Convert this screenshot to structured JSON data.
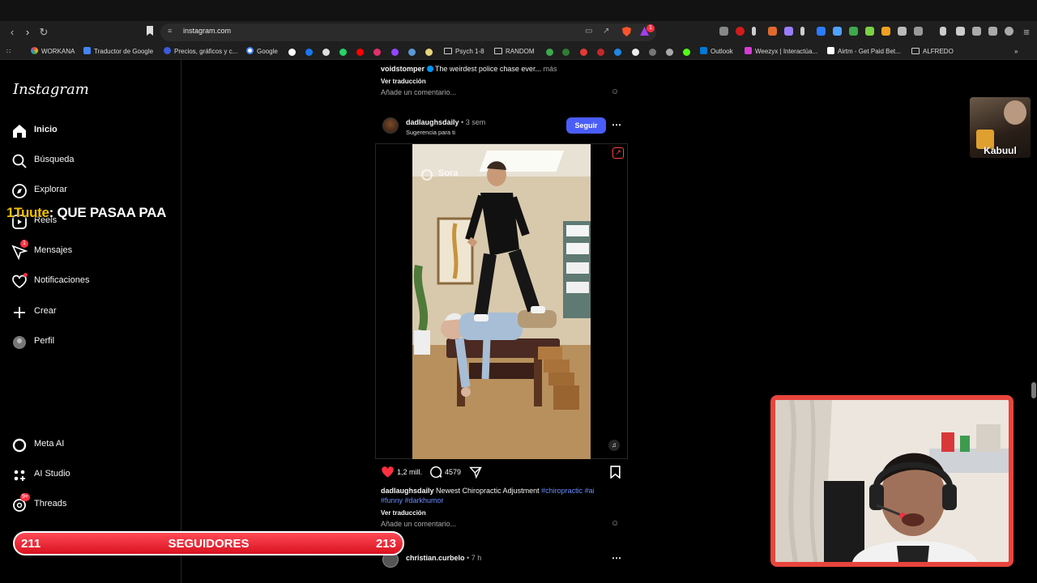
{
  "browser": {
    "url": "instagram.com",
    "bookmarks": [
      "WORKANA",
      "Traductor de Google",
      "Precios, gráficos y c...",
      "Google",
      "Psych 1-8",
      "RANDOM",
      "Outlook",
      "Weezyx | Interactúa...",
      "Airtm - Get Paid Bet...",
      "ALFREDO"
    ],
    "brave_badge": "1"
  },
  "sidebar": {
    "logo": "Instagram",
    "nav": [
      {
        "label": "Inicio",
        "icon": "home-icon",
        "active": true
      },
      {
        "label": "Búsqueda",
        "icon": "search-icon"
      },
      {
        "label": "Explorar",
        "icon": "compass-icon"
      },
      {
        "label": "Reels",
        "icon": "reels-icon"
      },
      {
        "label": "Mensajes",
        "icon": "messenger-icon",
        "badge": "1"
      },
      {
        "label": "Notificaciones",
        "icon": "heart-icon"
      },
      {
        "label": "Crear",
        "icon": "plus-icon"
      },
      {
        "label": "Perfil",
        "icon": "avatar-icon"
      }
    ],
    "bottom": [
      {
        "label": "Meta AI",
        "icon": "meta-ai-icon"
      },
      {
        "label": "AI Studio",
        "icon": "ai-studio-icon"
      },
      {
        "label": "Threads",
        "icon": "threads-icon",
        "badge": "9+"
      }
    ]
  },
  "prev_post": {
    "username": "voidstomper",
    "caption": "The weirdest police chase ever...",
    "more": "más",
    "translate": "Ver traducción",
    "comment_placeholder": "Añade un comentario..."
  },
  "post": {
    "username": "dadlaughsdaily",
    "time": "3 sem",
    "suggestion": "Sugerencia para ti",
    "follow": "Seguir",
    "watermark": "Sora",
    "likes": "1,2 mill.",
    "comments": "4579",
    "caption": "Newest Chiropractic Adjustment",
    "hashtags_line1": "#chiropractic #ai",
    "hashtags_line2": "#funny #darkhumor",
    "translate": "Ver traducción",
    "comment_placeholder": "Añade un comentario..."
  },
  "next_post": {
    "username": "christian.curbelo",
    "time": "7 h"
  },
  "overlay": {
    "chat_user": "1Tuute",
    "chat_message": ": QUE PASAA PAA",
    "followers_left": "211",
    "followers_label": "SEGUIDORES",
    "followers_right": "213",
    "guest_name": "Kabuul"
  }
}
